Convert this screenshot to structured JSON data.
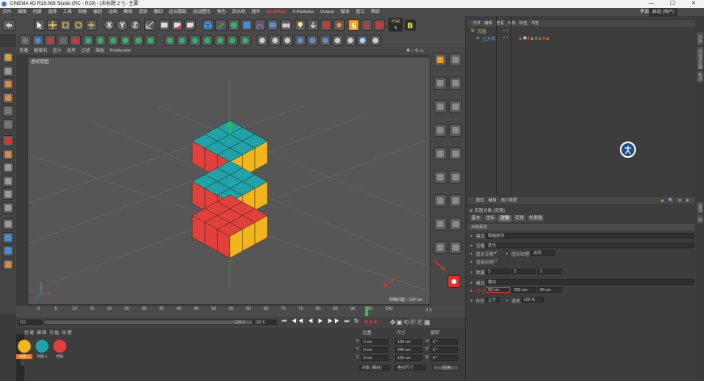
{
  "window": {
    "title": "CINEMA 4D R19.068 Studio (RC - R19) - [未标题 2 *] - 主要",
    "minimize": "—",
    "maximize": "☐",
    "close": "✕"
  },
  "menubar": [
    "文件",
    "编辑",
    "创建",
    "选择",
    "工具",
    "网格",
    "捕捉",
    "动画",
    "模拟",
    "渲染",
    "雕刻",
    "运动跟踪",
    "运动图形",
    "角色",
    "流水线",
    "插件",
    "RealFlow",
    "X-Particles",
    "Octane",
    "脚本",
    "窗口",
    "帮助"
  ],
  "menubar_right": {
    "layout_label": "界面",
    "layout_value": "启动 (用户)"
  },
  "toolbar": {
    "x": "X",
    "y": "Y",
    "z": "Z",
    "psr": "PSR",
    "psr_value": "0"
  },
  "viewport": {
    "menu": [
      "查看",
      "摄像机",
      "显示",
      "选项",
      "过滤",
      "面板",
      "ProRender"
    ],
    "label": "透视视图",
    "grid_spacing": "网格间距 : 100 cm"
  },
  "timeline": {
    "ticks": [
      "0",
      "5",
      "10",
      "15",
      "20",
      "25",
      "30",
      "35",
      "40",
      "45",
      "50",
      "55",
      "60",
      "65",
      "70",
      "75",
      "80",
      "85",
      "90",
      "95",
      "100"
    ],
    "end_frame": "0 F",
    "current": "0 F",
    "start": "0 F",
    "range_end": "100 F",
    "max": "120 F",
    "max2": "120 F"
  },
  "materials": {
    "menu": [
      "创建",
      "编辑",
      "功能",
      "纹理"
    ],
    "items": [
      {
        "name": "材质 2",
        "color": "#f0b400"
      },
      {
        "name": "材质 1",
        "color": "#19a3a3"
      },
      {
        "name": "材质",
        "color": "#e23a3a"
      }
    ]
  },
  "coordinates": {
    "headers": [
      "位置",
      "尺寸",
      "旋转"
    ],
    "rows": [
      {
        "axis": "X",
        "pos": "0 cm",
        "size": "135 cm",
        "rot_label": "H",
        "rot": "0 °"
      },
      {
        "axis": "Y",
        "pos": "0 cm",
        "size": "245 cm",
        "rot_label": "P",
        "rot": "0 °"
      },
      {
        "axis": "Z",
        "pos": "0 cm",
        "size": "135 cm",
        "rot_label": "B",
        "rot": "0 °"
      }
    ],
    "mode": "对象 (相对)",
    "size_mode": "绝对尺寸",
    "apply": "应用"
  },
  "objects": {
    "menu": [
      "文件",
      "编辑",
      "查看",
      "对象",
      "标签",
      "书签"
    ],
    "items": [
      {
        "name": "克隆",
        "color": "#8fcf5a"
      },
      {
        "name": "立方体",
        "color": "#5aa0d8"
      }
    ]
  },
  "attributes": {
    "menu": [
      "模式",
      "编辑",
      "用户数据"
    ],
    "object_title": "克隆对象 [克隆]",
    "tabs": [
      "基本",
      "坐标",
      "对象",
      "变换",
      "效果器"
    ],
    "section": "对象属性",
    "mode_label": "模式",
    "mode_value": "网格排列",
    "clone_label": "克隆",
    "clone_value": "迭代",
    "fix_clone_label": "固定克隆",
    "fix_texture_label": "固定纹理",
    "fix_texture_value": "关闭",
    "instance_label": "渲染实例",
    "count_label": "数量",
    "count": [
      "3",
      "3",
      "3"
    ],
    "mode2_label": "模式",
    "mode2_value": "端点",
    "size_label": "尺寸",
    "size": [
      "90 cm",
      "200 cm",
      "90 cm"
    ],
    "shape_label": "外形",
    "shape_value": "立方",
    "fill_label": "填充",
    "fill_value": "100 %"
  },
  "side_tabs": [
    "对象",
    "内容浏览器",
    "构造",
    "属性",
    "层"
  ],
  "colors": {
    "yellow": "#f2b61a",
    "teal": "#1fa3a8",
    "red": "#e2403a",
    "accent_red": "#e23030"
  }
}
